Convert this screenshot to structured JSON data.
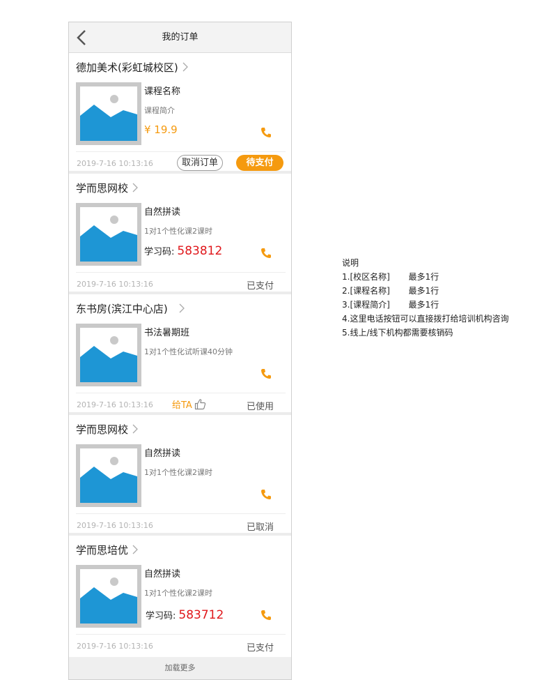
{
  "header": {
    "title": "我的订单",
    "back_icon": "chevron-left-icon"
  },
  "orders": [
    {
      "shop": "德加美术(彩虹城校区)",
      "course": "课程名称",
      "desc": "课程简介",
      "price": "¥ 19.9",
      "date": "2019-7-16 10:13:16",
      "cancel_label": "取消订单",
      "pay_label": "待支付"
    },
    {
      "shop": "学而思网校",
      "course": "自然拼读",
      "desc": "1对1个性化课2课时",
      "code_label": "学习码:",
      "code": "583812",
      "date": "2019-7-16 10:13:16",
      "status": "已支付"
    },
    {
      "shop": "东书房(滨江中心店)",
      "course": "书法暑期班",
      "desc": "1对1个性化试听课40分钟",
      "date": "2019-7-16 10:13:16",
      "give_label": "给TA",
      "status": "已使用"
    },
    {
      "shop": "学而思网校",
      "course": "自然拼读",
      "desc": "1对1个性化课2课时",
      "date": "2019-7-16 10:13:16",
      "status": "已取消"
    },
    {
      "shop": "学而思培优",
      "course": "自然拼读",
      "desc": "1对1个性化课2课时",
      "code_label": "学习码:",
      "code": "583712",
      "date": "2019-7-16 10:13:16",
      "status": "已支付"
    }
  ],
  "footer": {
    "load_more": "加载更多"
  },
  "notes": {
    "title": "说明",
    "items": [
      "1.[校区名称]       最多1行",
      "2.[课程名称]       最多1行",
      "3.[课程简介]       最多1行",
      "4.这里电话按钮可以直接拨打给培训机构咨询",
      "5.线上/线下机构都需要核销码"
    ]
  },
  "colors": {
    "accent": "#f59a0f",
    "code_red": "#e0171b",
    "thumb_blue": "#1e96d5"
  }
}
